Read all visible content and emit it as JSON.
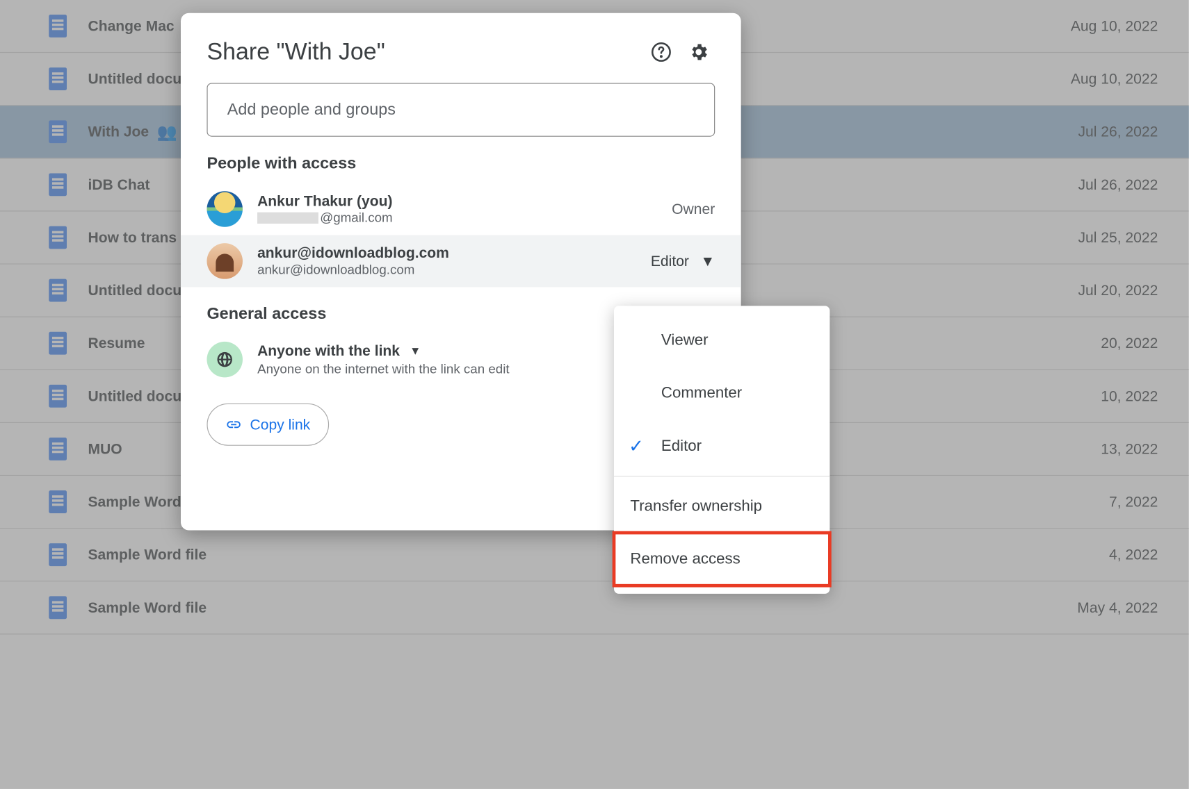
{
  "files": [
    {
      "name": "Change Mac",
      "date": "Aug 10, 2022",
      "shared": false
    },
    {
      "name": "Untitled docu",
      "date": "Aug 10, 2022",
      "shared": false
    },
    {
      "name": "With Joe",
      "date": "Jul 26, 2022",
      "shared": true,
      "selected": true
    },
    {
      "name": "iDB Chat",
      "date": "Jul 26, 2022",
      "shared": false
    },
    {
      "name": "How to trans",
      "date": "Jul 25, 2022",
      "shared": false
    },
    {
      "name": "Untitled docu",
      "date": "Jul 20, 2022",
      "shared": false
    },
    {
      "name": "Resume",
      "date": "20, 2022",
      "shared": false
    },
    {
      "name": "Untitled docu",
      "date": "10, 2022",
      "shared": false
    },
    {
      "name": "MUO",
      "date": "13, 2022",
      "shared": false
    },
    {
      "name": "Sample Word",
      "date": "7, 2022",
      "shared": false
    },
    {
      "name": "Sample Word file",
      "date": "4, 2022",
      "shared": false
    },
    {
      "name": "Sample Word file",
      "date": "May 4, 2022",
      "shared": false
    }
  ],
  "dialog": {
    "title": "Share \"With Joe\"",
    "add_placeholder": "Add people and groups",
    "people_heading": "People with access",
    "people": [
      {
        "name": "Ankur Thakur (you)",
        "email_suffix": "@gmail.com",
        "role": "Owner"
      },
      {
        "name": "ankur@idownloadblog.com",
        "email": "ankur@idownloadblog.com",
        "role": "Editor"
      }
    ],
    "general_heading": "General access",
    "general_title": "Anyone with the link",
    "general_sub": "Anyone on the internet with the link can edit",
    "copy_link": "Copy link"
  },
  "menu": {
    "viewer": "Viewer",
    "commenter": "Commenter",
    "editor": "Editor",
    "transfer": "Transfer ownership",
    "remove": "Remove access"
  }
}
